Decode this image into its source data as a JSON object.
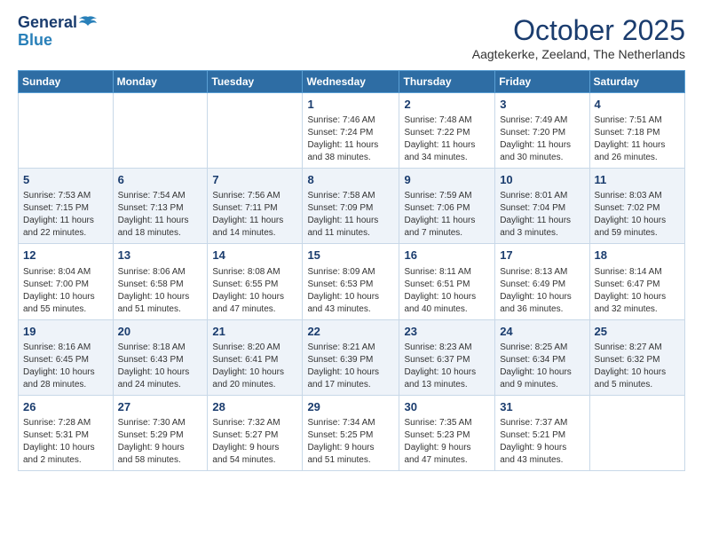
{
  "header": {
    "logo_line1": "General",
    "logo_line2": "Blue",
    "month_title": "October 2025",
    "location": "Aagtekerke, Zeeland, The Netherlands"
  },
  "weekdays": [
    "Sunday",
    "Monday",
    "Tuesday",
    "Wednesday",
    "Thursday",
    "Friday",
    "Saturday"
  ],
  "weeks": [
    [
      {
        "day": "",
        "info": ""
      },
      {
        "day": "",
        "info": ""
      },
      {
        "day": "",
        "info": ""
      },
      {
        "day": "1",
        "info": "Sunrise: 7:46 AM\nSunset: 7:24 PM\nDaylight: 11 hours\nand 38 minutes."
      },
      {
        "day": "2",
        "info": "Sunrise: 7:48 AM\nSunset: 7:22 PM\nDaylight: 11 hours\nand 34 minutes."
      },
      {
        "day": "3",
        "info": "Sunrise: 7:49 AM\nSunset: 7:20 PM\nDaylight: 11 hours\nand 30 minutes."
      },
      {
        "day": "4",
        "info": "Sunrise: 7:51 AM\nSunset: 7:18 PM\nDaylight: 11 hours\nand 26 minutes."
      }
    ],
    [
      {
        "day": "5",
        "info": "Sunrise: 7:53 AM\nSunset: 7:15 PM\nDaylight: 11 hours\nand 22 minutes."
      },
      {
        "day": "6",
        "info": "Sunrise: 7:54 AM\nSunset: 7:13 PM\nDaylight: 11 hours\nand 18 minutes."
      },
      {
        "day": "7",
        "info": "Sunrise: 7:56 AM\nSunset: 7:11 PM\nDaylight: 11 hours\nand 14 minutes."
      },
      {
        "day": "8",
        "info": "Sunrise: 7:58 AM\nSunset: 7:09 PM\nDaylight: 11 hours\nand 11 minutes."
      },
      {
        "day": "9",
        "info": "Sunrise: 7:59 AM\nSunset: 7:06 PM\nDaylight: 11 hours\nand 7 minutes."
      },
      {
        "day": "10",
        "info": "Sunrise: 8:01 AM\nSunset: 7:04 PM\nDaylight: 11 hours\nand 3 minutes."
      },
      {
        "day": "11",
        "info": "Sunrise: 8:03 AM\nSunset: 7:02 PM\nDaylight: 10 hours\nand 59 minutes."
      }
    ],
    [
      {
        "day": "12",
        "info": "Sunrise: 8:04 AM\nSunset: 7:00 PM\nDaylight: 10 hours\nand 55 minutes."
      },
      {
        "day": "13",
        "info": "Sunrise: 8:06 AM\nSunset: 6:58 PM\nDaylight: 10 hours\nand 51 minutes."
      },
      {
        "day": "14",
        "info": "Sunrise: 8:08 AM\nSunset: 6:55 PM\nDaylight: 10 hours\nand 47 minutes."
      },
      {
        "day": "15",
        "info": "Sunrise: 8:09 AM\nSunset: 6:53 PM\nDaylight: 10 hours\nand 43 minutes."
      },
      {
        "day": "16",
        "info": "Sunrise: 8:11 AM\nSunset: 6:51 PM\nDaylight: 10 hours\nand 40 minutes."
      },
      {
        "day": "17",
        "info": "Sunrise: 8:13 AM\nSunset: 6:49 PM\nDaylight: 10 hours\nand 36 minutes."
      },
      {
        "day": "18",
        "info": "Sunrise: 8:14 AM\nSunset: 6:47 PM\nDaylight: 10 hours\nand 32 minutes."
      }
    ],
    [
      {
        "day": "19",
        "info": "Sunrise: 8:16 AM\nSunset: 6:45 PM\nDaylight: 10 hours\nand 28 minutes."
      },
      {
        "day": "20",
        "info": "Sunrise: 8:18 AM\nSunset: 6:43 PM\nDaylight: 10 hours\nand 24 minutes."
      },
      {
        "day": "21",
        "info": "Sunrise: 8:20 AM\nSunset: 6:41 PM\nDaylight: 10 hours\nand 20 minutes."
      },
      {
        "day": "22",
        "info": "Sunrise: 8:21 AM\nSunset: 6:39 PM\nDaylight: 10 hours\nand 17 minutes."
      },
      {
        "day": "23",
        "info": "Sunrise: 8:23 AM\nSunset: 6:37 PM\nDaylight: 10 hours\nand 13 minutes."
      },
      {
        "day": "24",
        "info": "Sunrise: 8:25 AM\nSunset: 6:34 PM\nDaylight: 10 hours\nand 9 minutes."
      },
      {
        "day": "25",
        "info": "Sunrise: 8:27 AM\nSunset: 6:32 PM\nDaylight: 10 hours\nand 5 minutes."
      }
    ],
    [
      {
        "day": "26",
        "info": "Sunrise: 7:28 AM\nSunset: 5:31 PM\nDaylight: 10 hours\nand 2 minutes."
      },
      {
        "day": "27",
        "info": "Sunrise: 7:30 AM\nSunset: 5:29 PM\nDaylight: 9 hours\nand 58 minutes."
      },
      {
        "day": "28",
        "info": "Sunrise: 7:32 AM\nSunset: 5:27 PM\nDaylight: 9 hours\nand 54 minutes."
      },
      {
        "day": "29",
        "info": "Sunrise: 7:34 AM\nSunset: 5:25 PM\nDaylight: 9 hours\nand 51 minutes."
      },
      {
        "day": "30",
        "info": "Sunrise: 7:35 AM\nSunset: 5:23 PM\nDaylight: 9 hours\nand 47 minutes."
      },
      {
        "day": "31",
        "info": "Sunrise: 7:37 AM\nSunset: 5:21 PM\nDaylight: 9 hours\nand 43 minutes."
      },
      {
        "day": "",
        "info": ""
      }
    ]
  ]
}
